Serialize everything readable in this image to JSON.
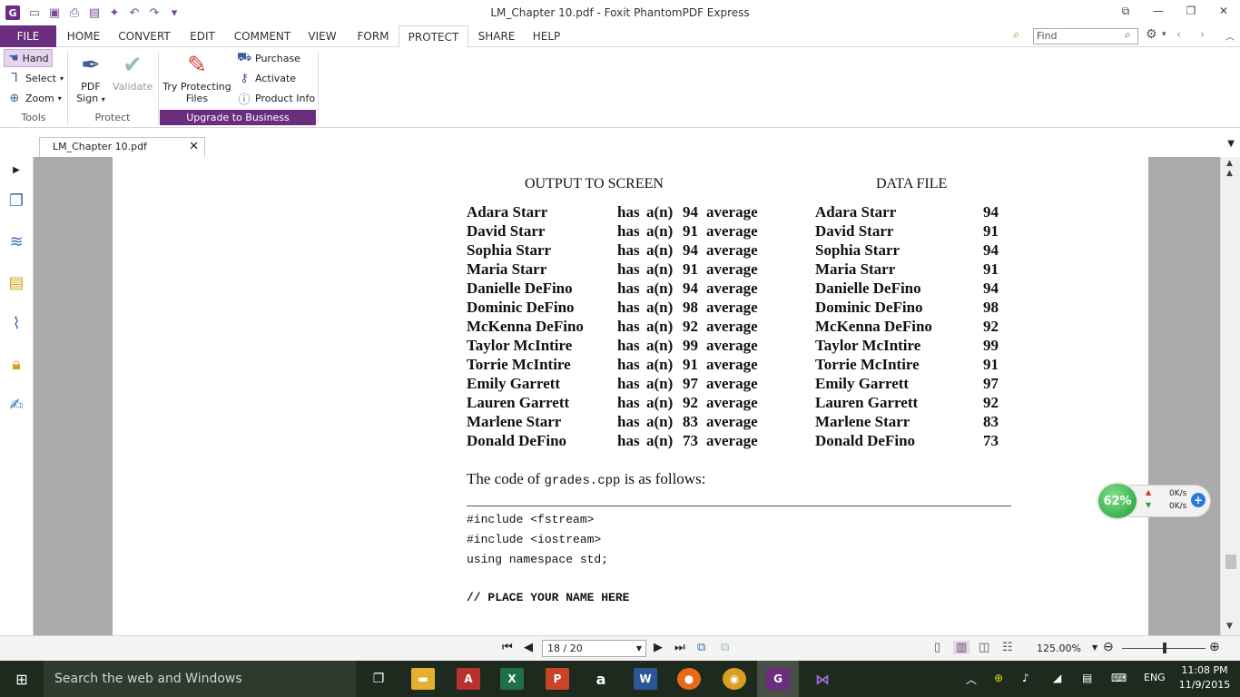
{
  "window": {
    "title": "LM_Chapter 10.pdf - Foxit PhantomPDF Express",
    "app_icon": "G"
  },
  "menu": {
    "tabs": [
      "FILE",
      "HOME",
      "CONVERT",
      "EDIT",
      "COMMENT",
      "VIEW",
      "FORM",
      "PROTECT",
      "SHARE",
      "HELP"
    ],
    "active": "PROTECT",
    "find_placeholder": "Find"
  },
  "ribbon": {
    "tools": {
      "hand": "Hand",
      "select": "Select",
      "zoom": "Zoom",
      "label": "Tools"
    },
    "protect": {
      "pdf_sign_1": "PDF",
      "pdf_sign_2": "Sign",
      "validate": "Validate",
      "label": "Protect"
    },
    "business": {
      "try_1": "Try Protecting",
      "try_2": "Files",
      "purchase": "Purchase",
      "activate": "Activate",
      "product_info": "Product Info",
      "upgrade": "Upgrade to Business"
    }
  },
  "doc_tab": {
    "name": "LM_Chapter 10.pdf"
  },
  "document": {
    "header_left": "OUTPUT TO SCREEN",
    "header_right": "DATA FILE",
    "phrase_has": "has",
    "phrase_an": "a(n)",
    "phrase_avg": "average",
    "rows": [
      {
        "name": "Adara Starr",
        "score": "94"
      },
      {
        "name": "David Starr",
        "score": "91"
      },
      {
        "name": "Sophia Starr",
        "score": "94"
      },
      {
        "name": "Maria Starr",
        "score": "91"
      },
      {
        "name": "Danielle DeFino",
        "score": "94"
      },
      {
        "name": "Dominic DeFino",
        "score": "98"
      },
      {
        "name": "McKenna DeFino",
        "score": "92"
      },
      {
        "name": "Taylor McIntire",
        "score": "99"
      },
      {
        "name": "Torrie McIntire",
        "score": "91"
      },
      {
        "name": "Emily Garrett",
        "score": "97"
      },
      {
        "name": "Lauren Garrett",
        "score": "92"
      },
      {
        "name": "Marlene Starr",
        "score": "83"
      },
      {
        "name": "Donald DeFino",
        "score": "73"
      }
    ],
    "para_before": "The code of ",
    "para_file": "grades.cpp",
    "para_after": " is as follows:",
    "code": [
      "#include <fstream>",
      "#include <iostream>",
      "using namespace std;"
    ],
    "code_comment": "// PLACE YOUR NAME HERE"
  },
  "net_widget": {
    "percent": "62%",
    "up": "0K/s",
    "down": "0K/s"
  },
  "status": {
    "page": "18 / 20",
    "zoom": "125.00%"
  },
  "taskbar": {
    "search_placeholder": "Search the web and Windows",
    "lang": "ENG",
    "time": "11:08 PM",
    "date": "11/9/2015"
  }
}
